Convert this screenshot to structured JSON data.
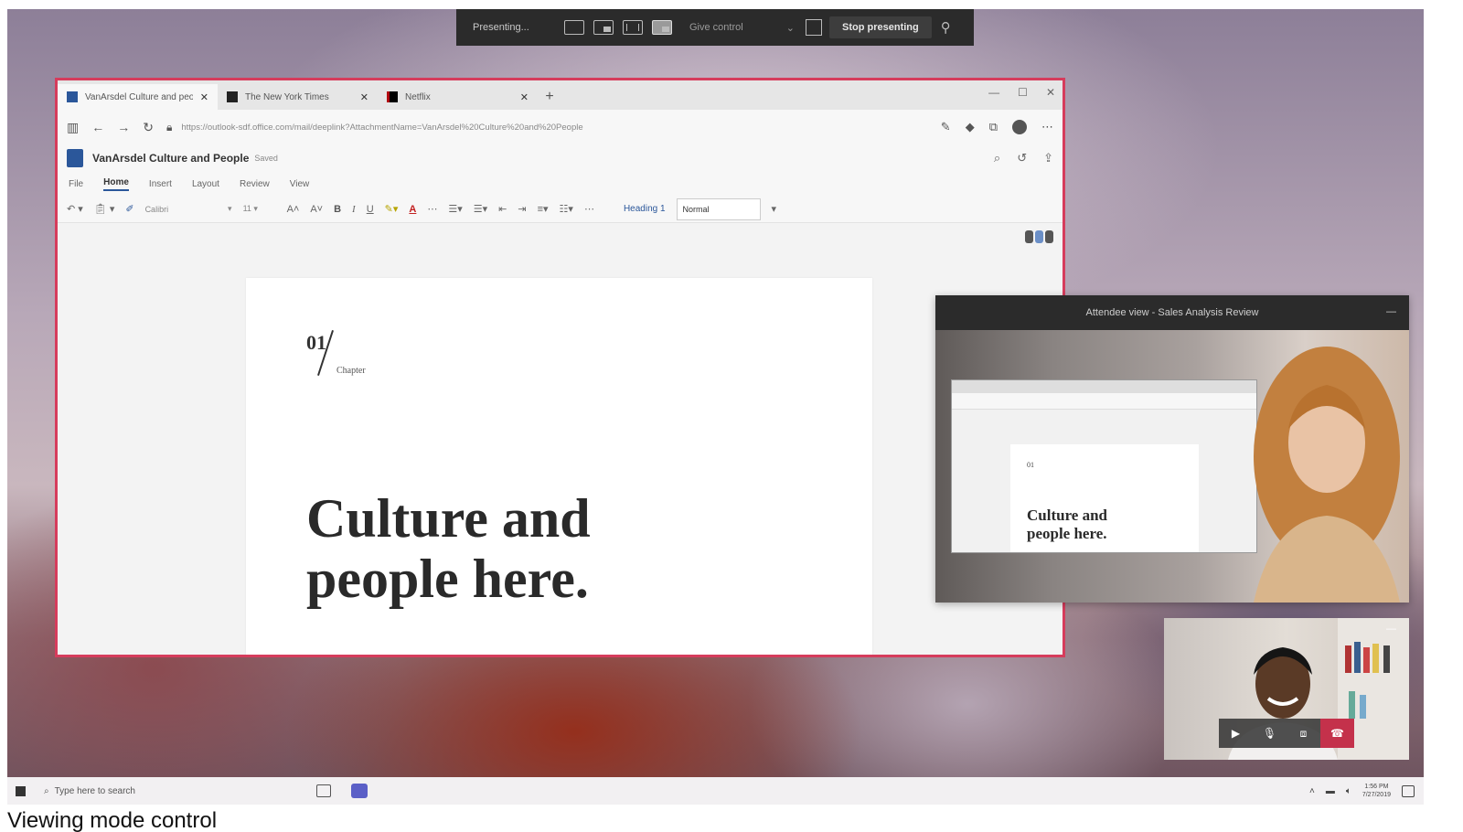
{
  "presenting_bar": {
    "status": "Presenting...",
    "give_control": "Give control",
    "stop_presenting": "Stop presenting"
  },
  "browser": {
    "tabs": [
      {
        "title": "VanArsdel Culture and peo...",
        "active": true,
        "color": "#2b579a"
      },
      {
        "title": "The New York Times",
        "active": false,
        "color": "#222222"
      },
      {
        "title": "Netflix",
        "active": false,
        "color": "#000000"
      }
    ],
    "url": "https://outlook-sdf.office.com/mail/deeplink?AttachmentName=VanArsdel%20Culture%20and%20People"
  },
  "word": {
    "doc_title": "VanArsdel Culture and People",
    "saved_status": "Saved",
    "menu_tabs": [
      "File",
      "Home",
      "Insert",
      "Layout",
      "Review",
      "View"
    ],
    "active_menu": "Home",
    "font_name": "Calibri",
    "font_size": "11",
    "style_heading": "Heading 1",
    "style_normal": "Normal"
  },
  "document": {
    "chapter_number": "01",
    "chapter_label": "Chapter",
    "heading_line1": "Culture and",
    "heading_line2": "people here."
  },
  "attendee_view": {
    "title": "Attendee view - Sales Analysis Review",
    "mini_heading_line1": "Culture and",
    "mini_heading_line2": "people here."
  },
  "taskbar": {
    "search_placeholder": "Type here to search",
    "time": "1:56 PM",
    "date": "7/27/2019"
  },
  "caption": "Viewing mode control",
  "colors": {
    "share_border": "#d63c5c",
    "word_blue": "#2b579a",
    "teams_purple": "#5b5fc7",
    "hang_up_red": "#c4314b"
  }
}
